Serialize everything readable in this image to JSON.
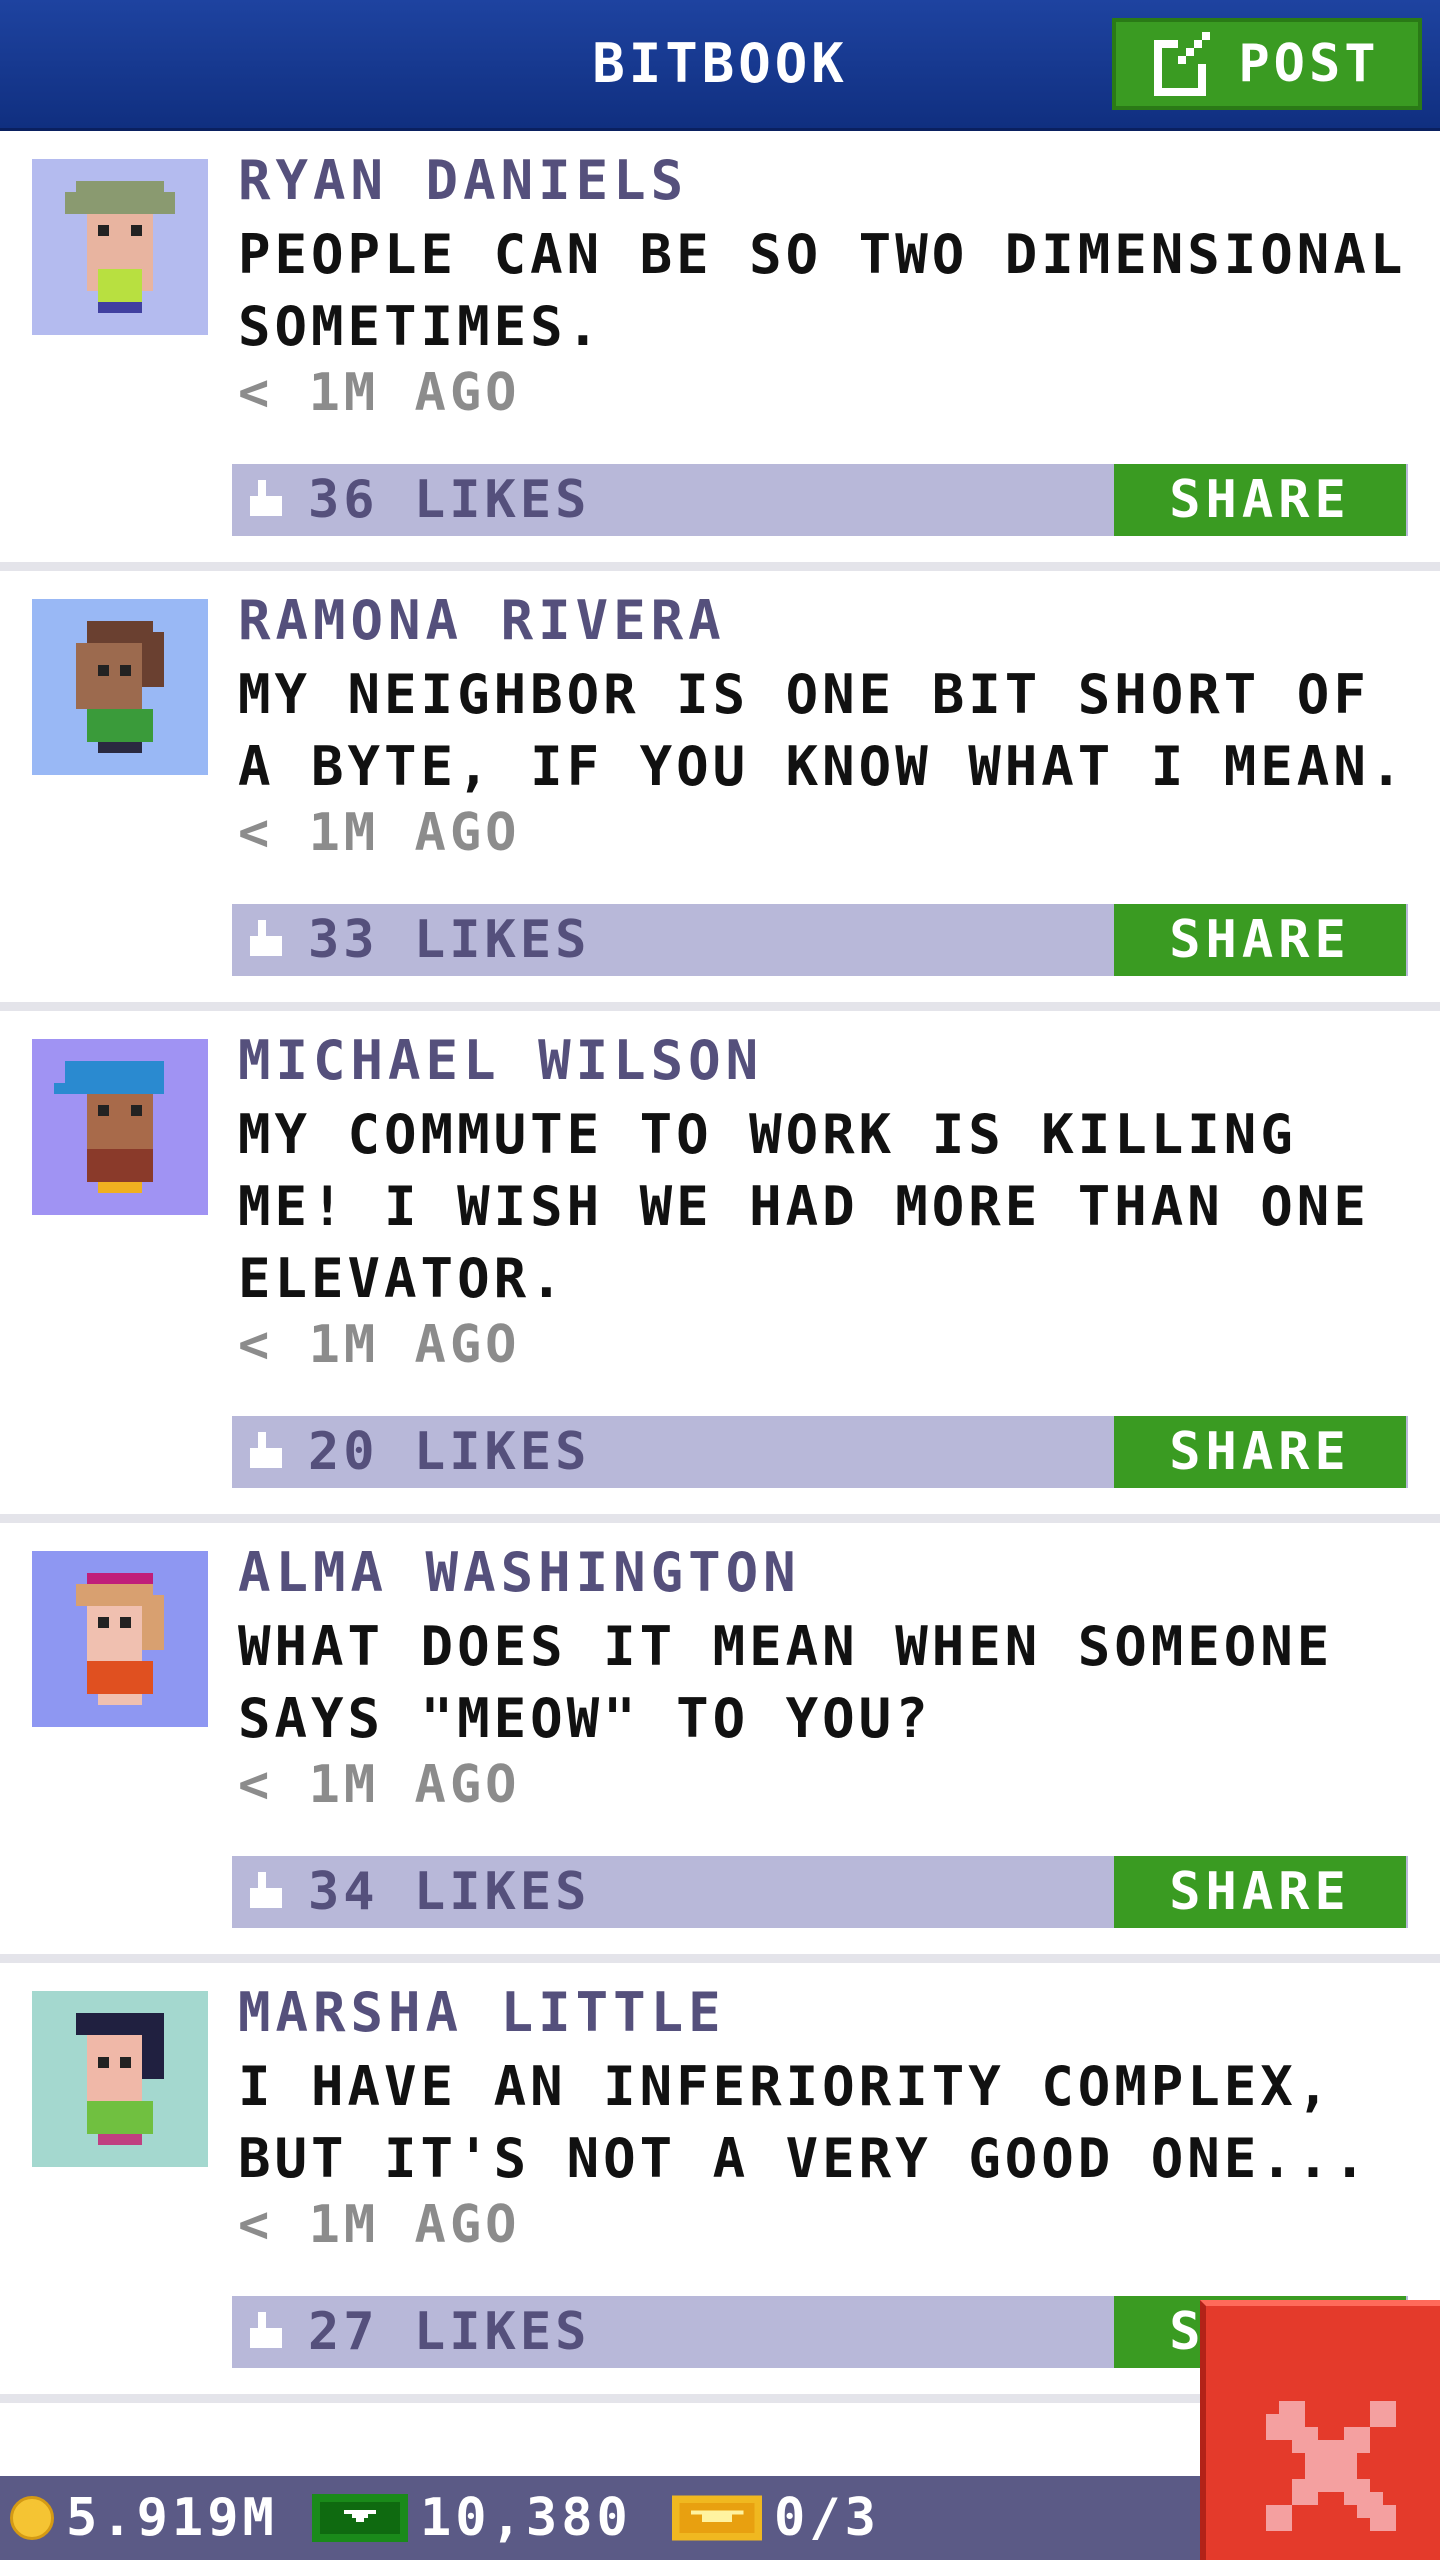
{
  "header": {
    "title": "BITBOOK",
    "post_label": "POST"
  },
  "posts": [
    {
      "author": "RYAN DANIELS",
      "message": "PEOPLE CAN BE SO TWO DIMENSIONAL SOMETIMES.",
      "time": "< 1M AGO",
      "likes": "36 LIKES",
      "share": "SHARE",
      "avatar_bg": "#b4bbef",
      "skin": "#e8b4a0",
      "hair": "#8a9a70",
      "shirt": "#b8e040"
    },
    {
      "author": "RAMONA RIVERA",
      "message": "MY NEIGHBOR IS ONE BIT SHORT OF A BYTE, IF YOU KNOW WHAT I MEAN.",
      "time": "< 1M AGO",
      "likes": "33 LIKES",
      "share": "SHARE",
      "avatar_bg": "#99b8f5",
      "skin": "#9c6a4e",
      "hair": "#6a4030",
      "shirt": "#3a9b3a"
    },
    {
      "author": "MICHAEL WILSON",
      "message": "MY COMMUTE TO WORK IS KILLING ME! I WISH WE HAD MORE THAN ONE ELEVATOR.",
      "time": "< 1M AGO",
      "likes": "20 LIKES",
      "share": "SHARE",
      "avatar_bg": "#a093f3",
      "skin": "#a86a4a",
      "hair": "#2a8ad0",
      "shirt": "#8a3a2a"
    },
    {
      "author": "ALMA WASHINGTON",
      "message": "WHAT DOES IT MEAN WHEN SOMEONE SAYS \"MEOW\" TO YOU?",
      "time": "< 1M AGO",
      "likes": "34 LIKES",
      "share": "SHARE",
      "avatar_bg": "#8e97f2",
      "skin": "#f0c0b0",
      "hair": "#c01e7a",
      "shirt": "#e05020"
    },
    {
      "author": "MARSHA LITTLE",
      "message": "I HAVE AN INFERIORITY COMPLEX, BUT IT'S NOT A VERY GOOD ONE...",
      "time": "< 1M AGO",
      "likes": "27 LIKES",
      "share": "SHARE",
      "avatar_bg": "#a4d8cf",
      "skin": "#f0b8a8",
      "hair": "#202040",
      "shirt": "#70c040"
    }
  ],
  "status_bar": {
    "coins": "5.919M",
    "bux": "10,380",
    "tickets": "0/3"
  },
  "colors": {
    "header": "#1a3c96",
    "accent_green": "#3a9b22",
    "like_bar": "#b8b8d9",
    "close_red": "#e43a2b"
  }
}
